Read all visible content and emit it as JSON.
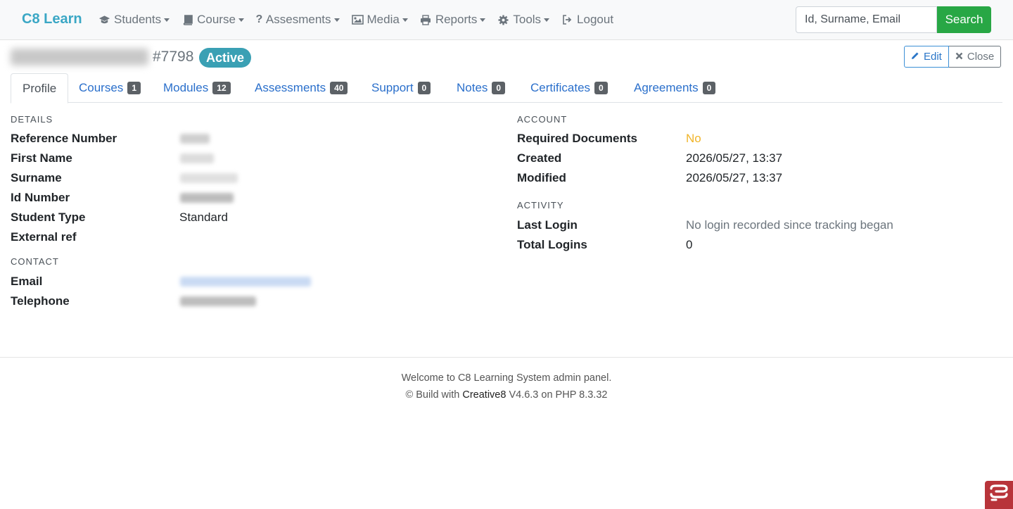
{
  "nav": {
    "brand": "C8 Learn",
    "items": [
      {
        "label": "Students",
        "icon": "graduation-cap-icon"
      },
      {
        "label": "Course",
        "icon": "book-icon"
      },
      {
        "label": "Assesments",
        "icon": "question-icon"
      },
      {
        "label": "Media",
        "icon": "image-icon"
      },
      {
        "label": "Reports",
        "icon": "printer-icon"
      },
      {
        "label": "Tools",
        "icon": "gear-icon"
      },
      {
        "label": "Logout",
        "icon": "sign-out-icon"
      }
    ],
    "search_placeholder": "Id, Surname, Email",
    "search_button": "Search"
  },
  "header": {
    "student_id": "#7798",
    "status": "Active",
    "edit_label": "Edit",
    "close_label": "Close"
  },
  "tabs": [
    {
      "label": "Profile",
      "count": null
    },
    {
      "label": "Courses",
      "count": "1"
    },
    {
      "label": "Modules",
      "count": "12"
    },
    {
      "label": "Assessments",
      "count": "40"
    },
    {
      "label": "Support",
      "count": "0"
    },
    {
      "label": "Notes",
      "count": "0"
    },
    {
      "label": "Certificates",
      "count": "0"
    },
    {
      "label": "Agreements",
      "count": "0"
    }
  ],
  "details": {
    "title": "DETAILS",
    "reference_label": "Reference Number",
    "first_name_label": "First Name",
    "surname_label": "Surname",
    "id_number_label": "Id Number",
    "student_type_label": "Student Type",
    "student_type_value": "Standard",
    "external_ref_label": "External ref"
  },
  "contact": {
    "title": "CONTACT",
    "email_label": "Email",
    "telephone_label": "Telephone"
  },
  "account": {
    "title": "ACCOUNT",
    "required_docs_label": "Required Documents",
    "required_docs_value": "No",
    "created_label": "Created",
    "created_value": "2026/05/27, 13:37",
    "modified_label": "Modified",
    "modified_value": "2026/05/27, 13:37"
  },
  "activity": {
    "title": "ACTIVITY",
    "last_login_label": "Last Login",
    "last_login_value": "No login recorded since tracking began",
    "total_logins_label": "Total Logins",
    "total_logins_value": "0"
  },
  "footer": {
    "line1": "Welcome to C8 Learning System admin panel.",
    "line2_prefix": "© Build with ",
    "line2_brand": "Creative8",
    "line2_suffix": " V4.6.3 on PHP 8.3.32"
  },
  "colors": {
    "brand": "#3aa7c5",
    "link": "#2a6fcb",
    "success": "#28a745",
    "active_badge": "#3aa0b4",
    "warning": "#f0b429"
  }
}
